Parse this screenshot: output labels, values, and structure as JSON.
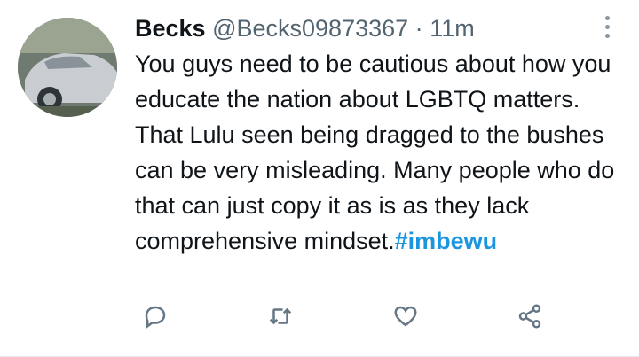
{
  "tweet": {
    "author_name": "Becks",
    "handle": "@Becks09873367",
    "separator": "·",
    "time": "11m",
    "text": "You guys need to be cautious about how you educate the nation about LGBTQ matters. That Lulu seen being dragged to the bushes can be very misleading. Many people who do that can just copy it as is as they lack comprehensive mindset.",
    "hashtag": "#imbewu"
  },
  "icons": {
    "avatar": "car-photo-avatar",
    "more": "more-vertical-icon",
    "reply": "reply-icon",
    "retweet": "retweet-icon",
    "like": "heart-icon",
    "share": "share-icon"
  },
  "colors": {
    "text": "#0f1419",
    "secondary": "#536471",
    "link": "#1b95e0",
    "icon": "#657786"
  }
}
